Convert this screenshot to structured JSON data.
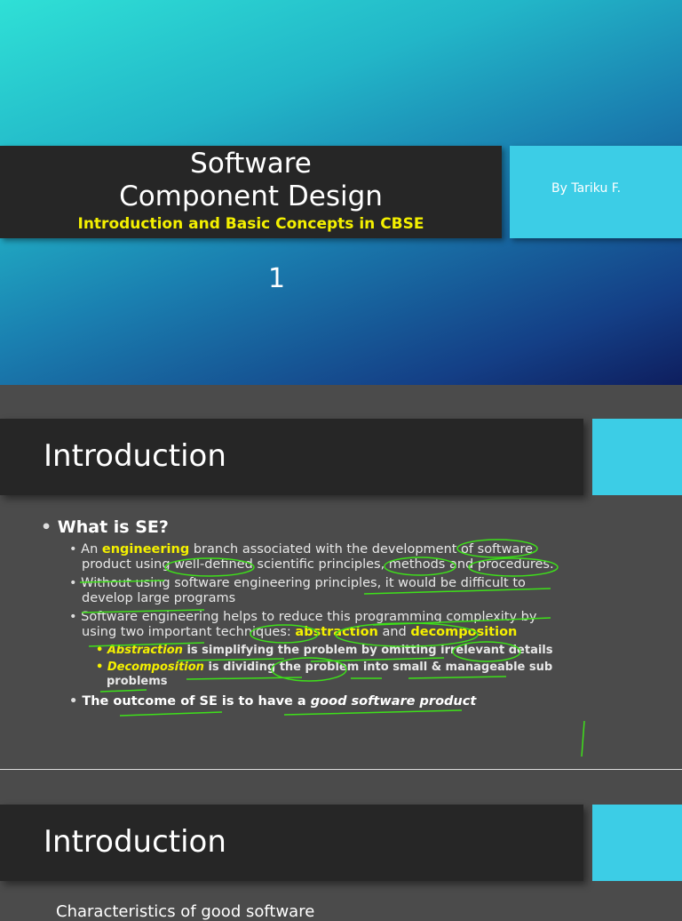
{
  "slide1": {
    "title_line1": "Software",
    "title_line2": "Component Design",
    "subtitle": "Introduction and Basic Concepts in CBSE",
    "author": "By Tariku F.",
    "page_number": "1"
  },
  "slide2": {
    "title": "Introduction",
    "heading": "What is SE?",
    "b1": {
      "pre": "An ",
      "hl": "engineering",
      "post": " branch associated with the development of software product using well-defined scientific principles, methods and procedures."
    },
    "b2": "Without using software engineering principles, it would be difficult to develop large programs",
    "b3": {
      "pre": "Software engineering helps to reduce this programming complexity by using two important techniques: ",
      "hl1": "abstraction",
      "mid": " and ",
      "hl2": "decomposition"
    },
    "s1": {
      "hl": "Abstraction",
      "post": " is simplifying the problem by omitting irrelevant details"
    },
    "s2": {
      "hl": "Decomposition",
      "post": " is dividing the problem into small & manageable sub problems"
    },
    "b4": {
      "pre": "The outcome of SE is to have a ",
      "em": "good software product"
    }
  },
  "slide3": {
    "title": "Introduction",
    "partial_text": "Characteristics of good software"
  }
}
